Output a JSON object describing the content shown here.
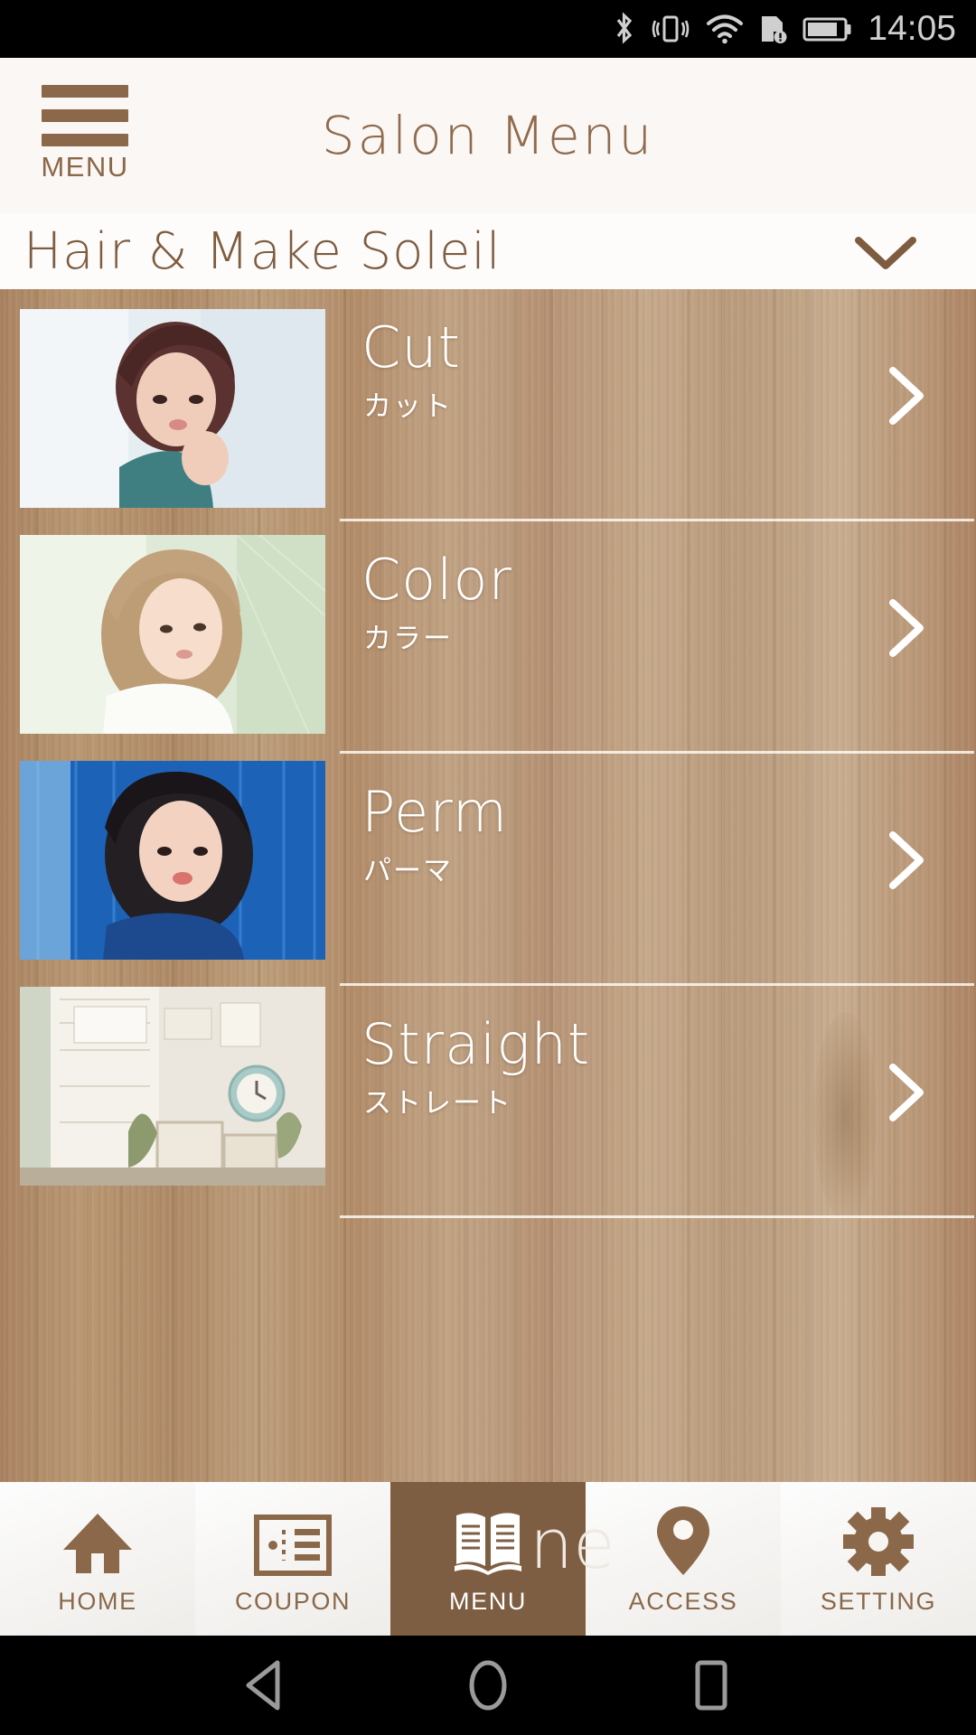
{
  "status_bar": {
    "time": "14:05",
    "icons": [
      "bluetooth-icon",
      "vibrate-icon",
      "wifi-icon",
      "sd-card-warning-icon",
      "battery-icon"
    ]
  },
  "app_bar": {
    "menu_button_label": "MENU",
    "menu_button_icon": "hamburger-icon",
    "title": "Salon Menu"
  },
  "salon_selector": {
    "name": "Hair & Make Soleil",
    "expand_icon": "chevron-down-icon"
  },
  "menu_list": {
    "items": [
      {
        "title": "Cut",
        "subtitle": "カット",
        "chevron": "chevron-right-icon"
      },
      {
        "title": "Color",
        "subtitle": "カラー",
        "chevron": "chevron-right-icon"
      },
      {
        "title": "Perm",
        "subtitle": "パーマ",
        "chevron": "chevron-right-icon"
      },
      {
        "title": "Straight",
        "subtitle": "ストレート",
        "chevron": "chevron-right-icon"
      }
    ]
  },
  "tab_bar": {
    "active": "MENU",
    "tabs": [
      {
        "label": "HOME",
        "icon": "house-icon"
      },
      {
        "label": "COUPON",
        "icon": "ticket-icon"
      },
      {
        "label": "MENU",
        "icon": "open-book-icon"
      },
      {
        "label": "ACCESS",
        "icon": "map-pin-icon"
      },
      {
        "label": "SETTING",
        "icon": "gear-icon"
      }
    ]
  },
  "system_nav": {
    "buttons": [
      {
        "name": "back-button",
        "icon": "triangle-left-icon"
      },
      {
        "name": "home-button",
        "icon": "circle-icon"
      },
      {
        "name": "recents-button",
        "icon": "square-icon"
      }
    ]
  },
  "colors": {
    "brand_brown": "#8a6849",
    "accent_dark_brown": "#7e5e42",
    "wood_base": "#b8956f",
    "header_bg": "#faf7f4"
  }
}
